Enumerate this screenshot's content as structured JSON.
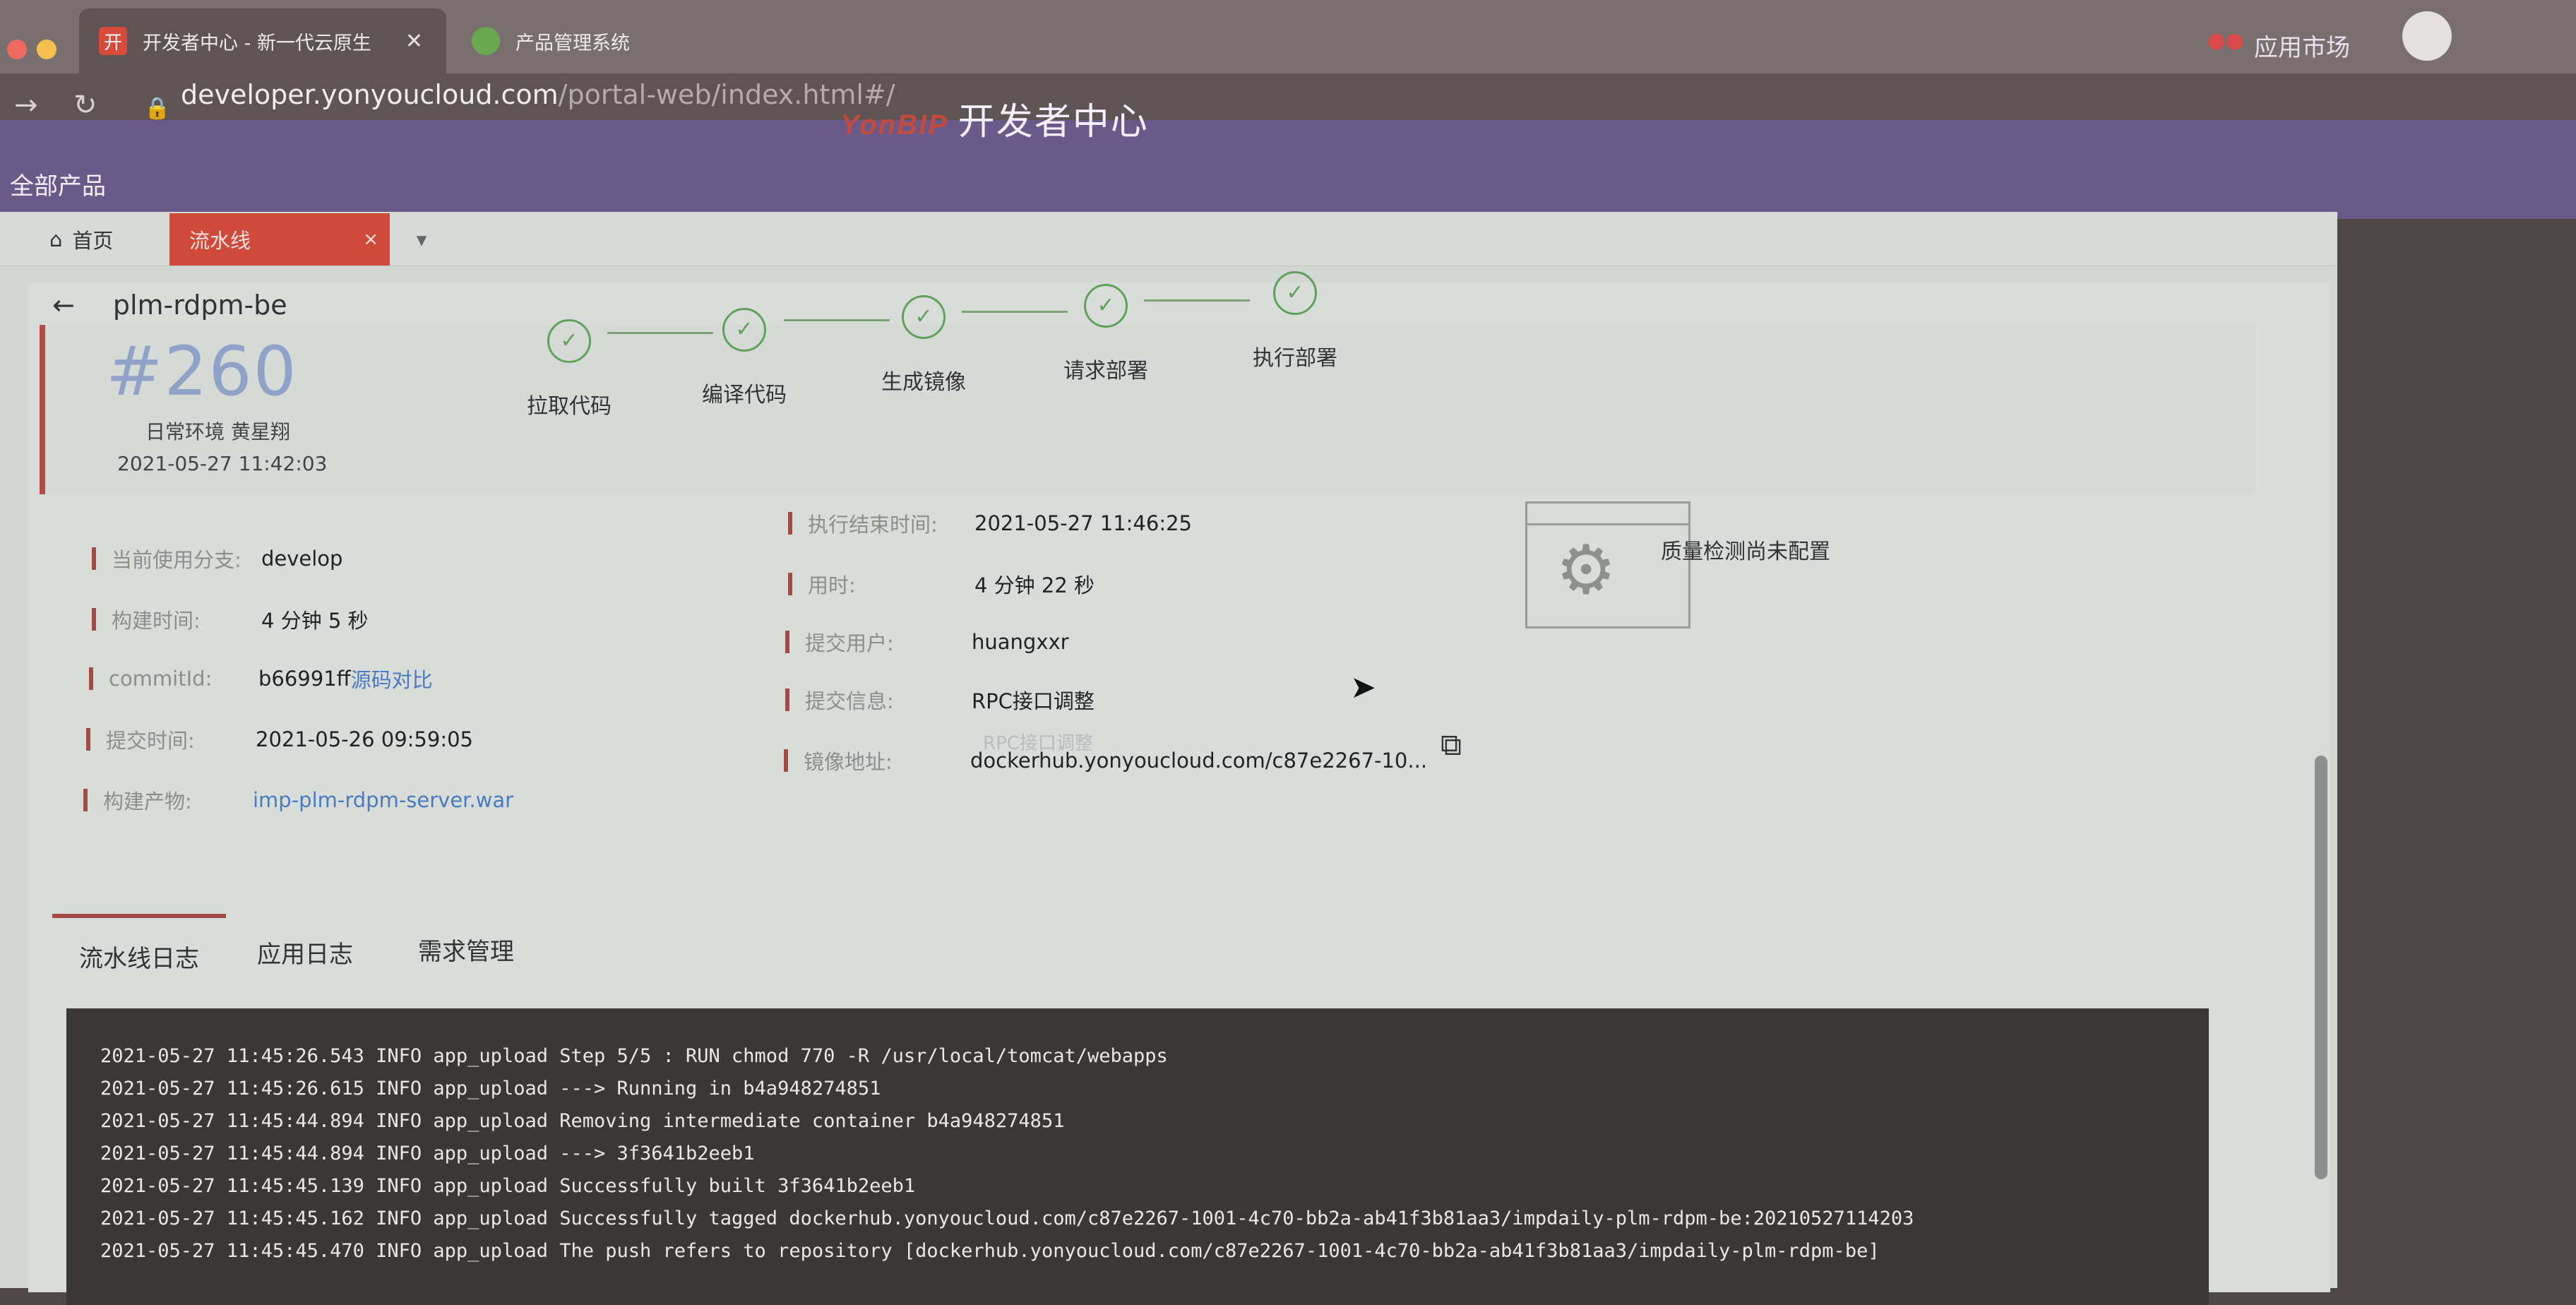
{
  "browser": {
    "tabs": [
      {
        "label": "开发者中心 - 新一代云原生",
        "favicon": "开"
      },
      {
        "label": "产品管理系统",
        "favicon": ""
      }
    ],
    "url_host": "developer.yonyoucloud.com",
    "url_path": "/portal-web/index.html#/"
  },
  "header": {
    "brand_logo": "YonBIP",
    "brand_title": "开发者中心",
    "app_market": "应用市场",
    "all_products": "全部产品"
  },
  "app_tabs": {
    "home": "首页",
    "pipeline": "流水线",
    "close": "×"
  },
  "project": {
    "back": "←",
    "name": "plm-rdpm-be"
  },
  "build": {
    "number": "#260",
    "env": "日常环境 黄星翔",
    "time": "2021-05-27 11:42:03",
    "steps": [
      "拉取代码",
      "编译代码",
      "生成镜像",
      "请求部署",
      "执行部署"
    ]
  },
  "details_left": [
    {
      "label": "当前使用分支:",
      "value": "develop"
    },
    {
      "label": "构建时间:",
      "value": "4 分钟 5 秒"
    },
    {
      "label": "commitId:",
      "value": "b66991ff",
      "link": "源码对比"
    },
    {
      "label": "提交时间:",
      "value": "2021-05-26 09:59:05"
    },
    {
      "label": "构建产物:",
      "link": "imp-plm-rdpm-server.war"
    }
  ],
  "details_right": [
    {
      "label": "执行结束时间:",
      "value": "2021-05-27 11:46:25"
    },
    {
      "label": "用时:",
      "value": "4 分钟 22 秒"
    },
    {
      "label": "提交用户:",
      "value": "huangxxr"
    },
    {
      "label": "提交信息:",
      "value": "RPC接口调整"
    },
    {
      "label": "镜像地址:",
      "value": "dockerhub.yonyoucloud.com/c87e2267-10..."
    }
  ],
  "tooltip": "RPC接口调整",
  "quality": "质量检测尚未配置",
  "log_tabs": [
    "流水线日志",
    "应用日志",
    "需求管理"
  ],
  "logs": [
    "2021-05-27 11:45:26.543 INFO app_upload Step 5/5 : RUN chmod 770 -R /usr/local/tomcat/webapps",
    "2021-05-27 11:45:26.615 INFO app_upload ---> Running in b4a948274851",
    "2021-05-27 11:45:44.894 INFO app_upload Removing intermediate container b4a948274851",
    "2021-05-27 11:45:44.894 INFO app_upload ---> 3f3641b2eeb1",
    "2021-05-27 11:45:45.139 INFO app_upload Successfully built 3f3641b2eeb1",
    "2021-05-27 11:45:45.162 INFO app_upload Successfully tagged dockerhub.yonyoucloud.com/c87e2267-1001-4c70-bb2a-ab41f3b81aa3/impdaily-plm-rdpm-be:20210527114203",
    "2021-05-27 11:45:45.470 INFO app_upload The push refers to repository [dockerhub.yonyoucloud.com/c87e2267-1001-4c70-bb2a-ab41f3b81aa3/impdaily-plm-rdpm-be]"
  ]
}
